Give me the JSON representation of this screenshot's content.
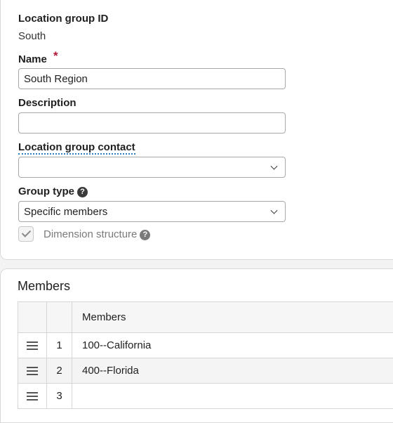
{
  "form": {
    "location_group_id_label": "Location group ID",
    "location_group_id_value": "South",
    "name_label": "Name",
    "required_marker": "*",
    "name_value": "South Region",
    "description_label": "Description",
    "description_value": "",
    "contact_label": "Location group contact",
    "contact_value": "",
    "group_type_label": "Group type",
    "group_type_value": "Specific members",
    "dimension_structure_label": "Dimension structure",
    "dimension_structure_checked": true,
    "help_glyph": "?"
  },
  "members": {
    "section_title": "Members",
    "column_header": "Members",
    "rows": [
      {
        "num": "1",
        "value": "100--California"
      },
      {
        "num": "2",
        "value": "400--Florida"
      },
      {
        "num": "3",
        "value": ""
      }
    ]
  },
  "icons": {
    "required": "required-asterisk",
    "help": "question-circle-icon",
    "dropdown": "chevron-down-icon",
    "check": "checkmark-icon",
    "drag": "drag-handle-icon"
  }
}
